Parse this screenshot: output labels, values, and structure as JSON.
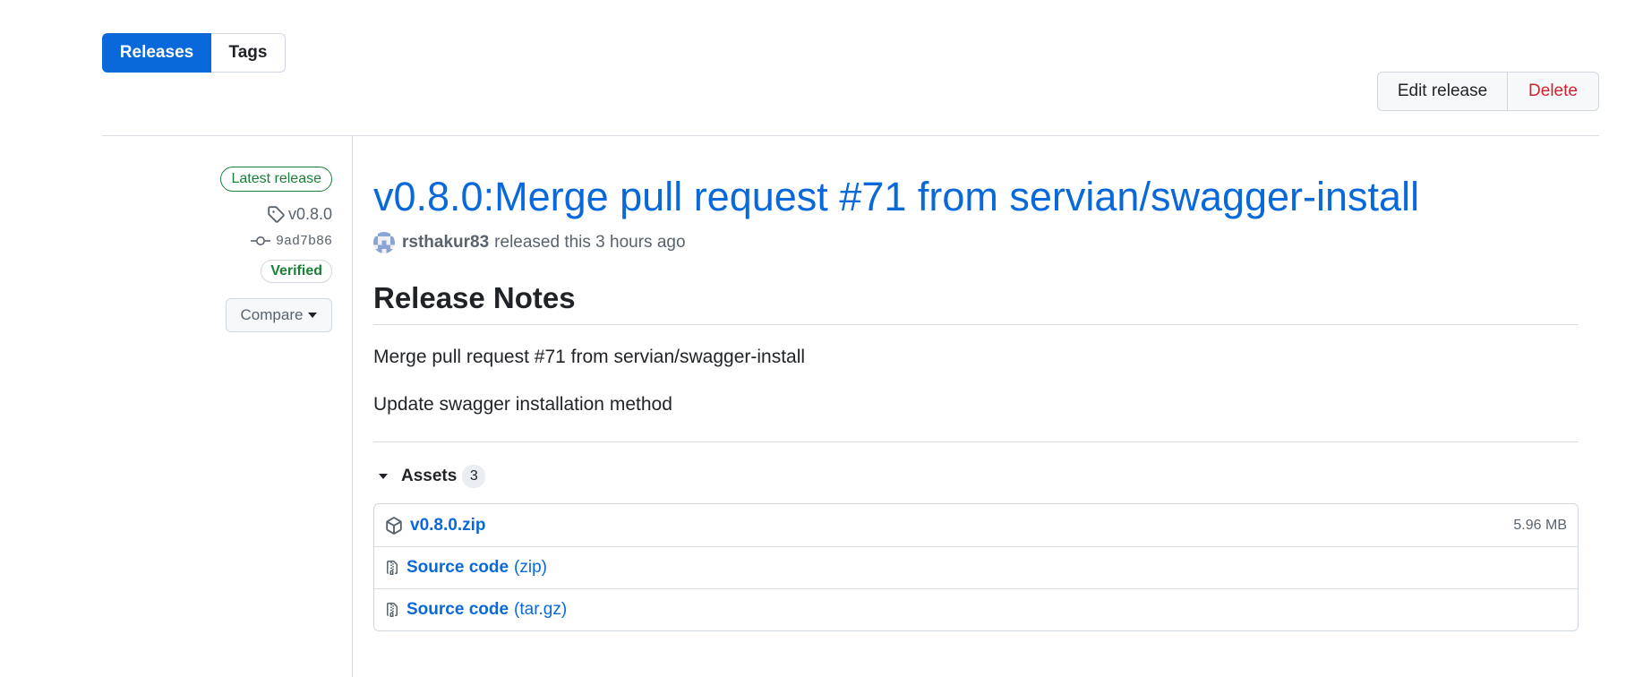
{
  "subnav": {
    "releases": "Releases",
    "tags": "Tags"
  },
  "actions": {
    "edit": "Edit release",
    "delete": "Delete"
  },
  "sidebar": {
    "latest_badge": "Latest release",
    "tag": "v0.8.0",
    "commit": "9ad7b86",
    "verified": "Verified",
    "compare": "Compare"
  },
  "release": {
    "title": "v0.8.0:Merge pull request #71 from servian/swagger-install",
    "author": "rsthakur83",
    "released_text": "released this 3 hours ago",
    "notes_heading": "Release Notes",
    "paragraphs": [
      "Merge pull request #71 from servian/swagger-install",
      "Update swagger installation method"
    ]
  },
  "assets": {
    "label": "Assets",
    "count": "3",
    "items": [
      {
        "name": "v0.8.0.zip",
        "suffix": "",
        "size": "5.96 MB",
        "icon": "package-icon"
      },
      {
        "name": "Source code",
        "suffix": "(zip)",
        "size": "",
        "icon": "file-zip-icon"
      },
      {
        "name": "Source code",
        "suffix": "(tar.gz)",
        "size": "",
        "icon": "file-zip-icon"
      }
    ]
  },
  "colors": {
    "accent": "#0969da",
    "danger": "#cf222e",
    "success": "#1a7f37",
    "muted": "#59636e",
    "border": "#d0d7de"
  }
}
